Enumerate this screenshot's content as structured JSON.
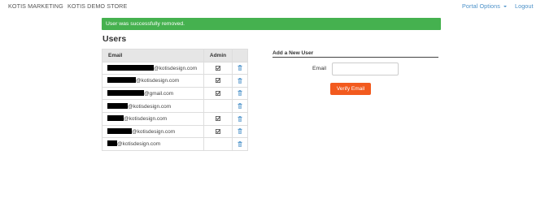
{
  "nav": {
    "left": [
      "KOTIS MARKETING",
      "KOTIS DEMO STORE"
    ],
    "portal_options": "Portal Options",
    "logout": "Logout"
  },
  "alert": {
    "message": "User was successfully removed.",
    "color": "#45b14f"
  },
  "page_title": "Users",
  "table": {
    "headers": {
      "email": "Email",
      "admin": "Admin",
      "actions": ""
    },
    "rows": [
      {
        "email_suffix": "@kotisdesign.com",
        "admin": true
      },
      {
        "email_suffix": "@kotisdesign.com",
        "admin": true
      },
      {
        "email_suffix": "@gmail.com",
        "admin": true
      },
      {
        "email_suffix": "@kotisdesign.com",
        "admin": false
      },
      {
        "email_suffix": "@kotisdesign.com",
        "admin": true
      },
      {
        "email_suffix": "@kotisdesign.com",
        "admin": true
      },
      {
        "email_suffix": "@kotisdesign.com",
        "admin": false
      }
    ]
  },
  "add_user": {
    "heading": "Add a New User",
    "email_label": "Email",
    "email_value": "",
    "email_placeholder": "",
    "verify_button": "Verify Email",
    "button_color": "#f25a1e"
  },
  "icons": {
    "admin_checked": "checked-box-icon",
    "delete": "trash-icon",
    "portal_menu": "caret-down-icon"
  }
}
